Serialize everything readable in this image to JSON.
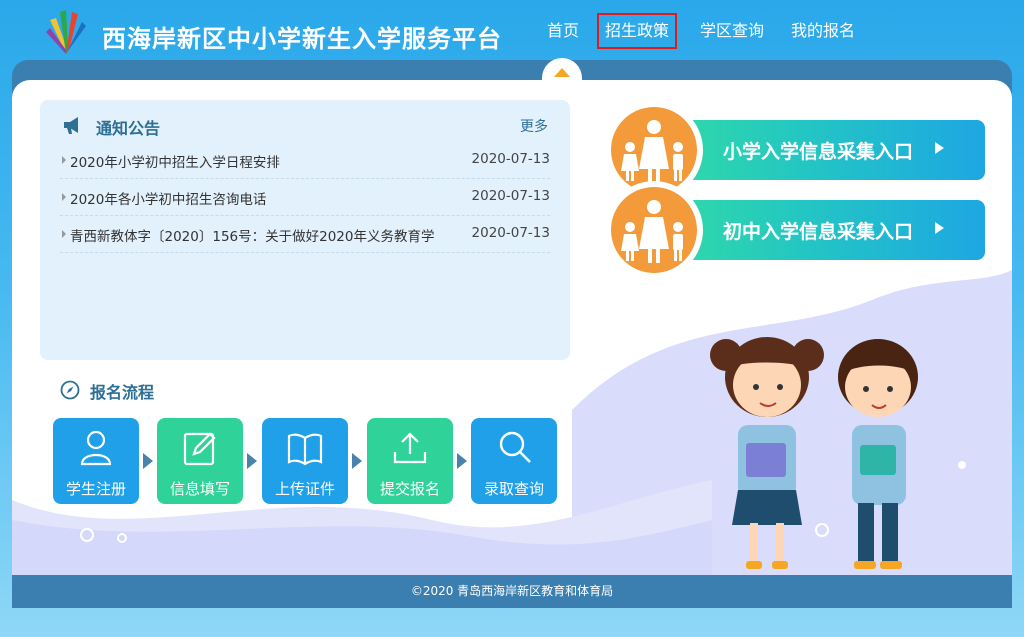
{
  "header": {
    "title": "西海岸新区中小学新生入学服务平台",
    "nav": [
      {
        "label": "首页",
        "active": false
      },
      {
        "label": "招生政策",
        "active": true
      },
      {
        "label": "学区查询",
        "active": false
      },
      {
        "label": "我的报名",
        "active": false
      }
    ]
  },
  "notice": {
    "title": "通知公告",
    "more": "更多",
    "items": [
      {
        "text": "2020年小学初中招生入学日程安排",
        "date": "2020-07-13"
      },
      {
        "text": "2020年各小学初中招生咨询电话",
        "date": "2020-07-13"
      },
      {
        "text": "青西新教体字〔2020〕156号：关于做好2020年义务教育学",
        "date": "2020-07-13"
      }
    ]
  },
  "process": {
    "title": "报名流程",
    "steps": [
      {
        "label": "学生注册",
        "icon": "user-icon",
        "color": "#1fa0e8"
      },
      {
        "label": "信息填写",
        "icon": "edit-icon",
        "color": "#2fd39a"
      },
      {
        "label": "上传证件",
        "icon": "book-icon",
        "color": "#1fa0e8"
      },
      {
        "label": "提交报名",
        "icon": "upload-icon",
        "color": "#2fd39a"
      },
      {
        "label": "录取查询",
        "icon": "search-icon",
        "color": "#1fa0e8"
      }
    ]
  },
  "entries": [
    {
      "label": "小学入学信息采集入口"
    },
    {
      "label": "初中入学信息采集入口"
    }
  ],
  "footer": {
    "text": "©2020 青岛西海岸新区教育和体育局"
  },
  "colors": {
    "accent_orange": "#f39a3b",
    "accent_teal": "#23c4c5",
    "frame_blue": "#3a7fb0",
    "active_nav_border": "#e01b1b"
  }
}
